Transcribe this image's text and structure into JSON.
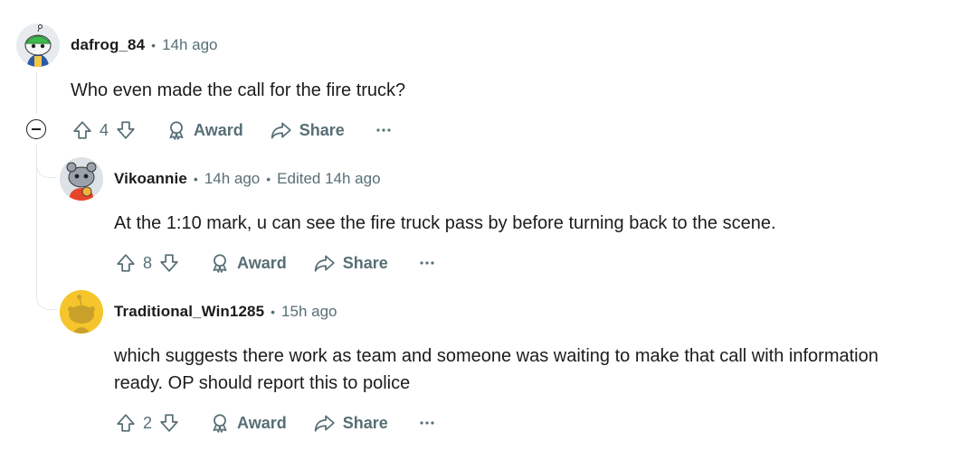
{
  "comments": [
    {
      "username": "dafrog_84",
      "time": "14h ago",
      "body": "Who even made the call for the fire truck?",
      "score": "4",
      "award_label": "Award",
      "share_label": "Share"
    },
    {
      "username": "Vikoannie",
      "time": "14h ago",
      "edited": "Edited 14h ago",
      "body": "At the 1:10 mark, u can see the fire truck pass by before turning back to the scene.",
      "score": "8",
      "award_label": "Award",
      "share_label": "Share"
    },
    {
      "username": "Traditional_Win1285",
      "time": "15h ago",
      "body": "which suggests there work as team and someone was waiting to make that call with information\nready. OP should report this to police",
      "score": "2",
      "award_label": "Award",
      "share_label": "Share"
    }
  ],
  "separator": "•",
  "icons": {
    "upvote": "upvote-icon",
    "downvote": "downvote-icon",
    "award": "award-icon",
    "share": "share-icon",
    "more": "more-icon",
    "collapse": "collapse-icon"
  },
  "colors": {
    "text": "#1c1c1c",
    "meta": "#576f76",
    "thread_line": "#e5e9eb"
  }
}
